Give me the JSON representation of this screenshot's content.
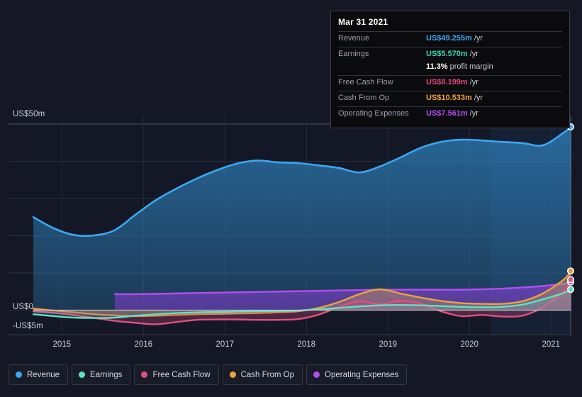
{
  "tooltip": {
    "title": "Mar 31 2021",
    "rows": [
      {
        "key": "Revenue",
        "value": "US$49.255m",
        "suffix": "/yr",
        "color": "#3ba7f0"
      },
      {
        "key": "Earnings",
        "value": "US$5.570m",
        "suffix": "/yr",
        "color": "#3ad6b5"
      },
      {
        "key": "",
        "value": "11.3%",
        "suffix": "profit margin",
        "color": "#ffffff"
      },
      {
        "key": "Free Cash Flow",
        "value": "US$8.199m",
        "suffix": "/yr",
        "color": "#e4457f"
      },
      {
        "key": "Cash From Op",
        "value": "US$10.533m",
        "suffix": "/yr",
        "color": "#eda13f"
      },
      {
        "key": "Operating Expenses",
        "value": "US$7.561m",
        "suffix": "/yr",
        "color": "#b44df0"
      }
    ]
  },
  "legend": {
    "items": [
      {
        "label": "Revenue",
        "color": "#3ba7f0"
      },
      {
        "label": "Earnings",
        "color": "#5ce4c4"
      },
      {
        "label": "Free Cash Flow",
        "color": "#e0517f"
      },
      {
        "label": "Cash From Op",
        "color": "#eda13f"
      },
      {
        "label": "Operating Expenses",
        "color": "#b44df0"
      }
    ]
  },
  "axis": {
    "y_labels": [
      "US$50m",
      "US$0",
      "-US$5m"
    ],
    "y_top": "US$50m",
    "y_zero": "US$0",
    "y_bottom": "-US$5m",
    "x_labels": [
      "2015",
      "2016",
      "2017",
      "2018",
      "2019",
      "2020",
      "2021"
    ]
  },
  "chart_data": {
    "type": "area",
    "title": "",
    "xlabel": "",
    "ylabel": "US$ millions",
    "ylim": [
      -5,
      50
    ],
    "xlim": [
      2014.65,
      2021.25
    ],
    "grid": true,
    "gridlines_y": [
      0,
      10,
      20,
      30,
      40,
      50
    ],
    "legend_position": "bottom",
    "x": [
      2014.65,
      2014.9,
      2015.15,
      2015.4,
      2015.65,
      2015.9,
      2016.15,
      2016.4,
      2016.65,
      2016.9,
      2017.15,
      2017.4,
      2017.65,
      2017.9,
      2018.15,
      2018.4,
      2018.65,
      2018.9,
      2019.15,
      2019.4,
      2019.65,
      2019.9,
      2020.15,
      2020.4,
      2020.65,
      2020.9,
      2021.15,
      2021.25
    ],
    "series": [
      {
        "name": "Revenue",
        "color": "#3ba7f0",
        "values": [
          25.0,
          22.0,
          20.2,
          20.1,
          21.5,
          25.6,
          29.5,
          32.6,
          35.3,
          37.6,
          39.4,
          40.2,
          39.7,
          39.5,
          38.9,
          38.2,
          37.0,
          38.6,
          41.0,
          43.6,
          45.2,
          45.8,
          45.6,
          45.2,
          44.9,
          44.3,
          47.6,
          49.255
        ]
      },
      {
        "name": "Earnings",
        "color": "#5ce4c4",
        "values": [
          -1.1,
          -1.6,
          -2.0,
          -2.1,
          -2.0,
          -1.5,
          -1.1,
          -0.8,
          -0.6,
          -0.5,
          -0.4,
          -0.3,
          -0.2,
          -0.1,
          0.2,
          0.6,
          1.0,
          1.3,
          1.4,
          1.3,
          1.1,
          0.9,
          0.8,
          0.9,
          1.5,
          2.9,
          4.6,
          5.57
        ]
      },
      {
        "name": "Free Cash Flow",
        "color": "#e0517f",
        "values": [
          -0.3,
          -0.7,
          -1.3,
          -2.1,
          -2.9,
          -3.4,
          -3.8,
          -3.2,
          -2.6,
          -2.5,
          -2.5,
          -2.6,
          -2.6,
          -2.4,
          -1.2,
          0.9,
          2.4,
          1.6,
          2.5,
          1.8,
          -0.3,
          -1.6,
          -1.3,
          -1.7,
          -1.5,
          0.8,
          5.0,
          8.199
        ]
      },
      {
        "name": "Cash From Op",
        "color": "#eda13f",
        "values": [
          0.4,
          -0.1,
          -0.6,
          -1.1,
          -1.4,
          -1.6,
          -1.5,
          -1.3,
          -1.1,
          -1.0,
          -0.9,
          -0.8,
          -0.6,
          -0.3,
          0.6,
          2.2,
          4.3,
          5.6,
          4.5,
          3.4,
          2.5,
          1.9,
          1.7,
          1.7,
          2.4,
          4.5,
          8.1,
          10.533
        ]
      },
      {
        "name": "Operating Expenses",
        "color": "#b44df0",
        "values": [
          null,
          null,
          null,
          null,
          4.3,
          4.3,
          4.4,
          4.5,
          4.6,
          4.7,
          4.8,
          4.9,
          5.0,
          5.1,
          5.2,
          5.3,
          5.4,
          5.5,
          5.5,
          5.5,
          5.5,
          5.5,
          5.6,
          5.8,
          6.1,
          6.5,
          7.1,
          7.561
        ]
      }
    ]
  }
}
